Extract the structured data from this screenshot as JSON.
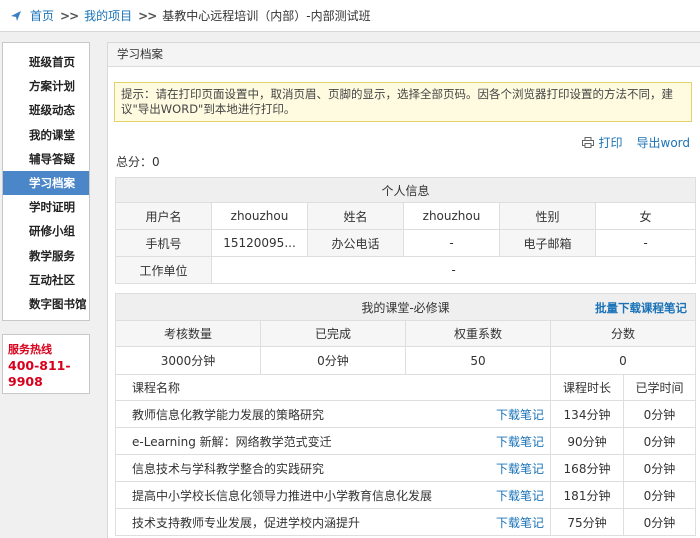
{
  "breadcrumb": {
    "home": "首页",
    "sep": ">>",
    "project": "我的项目",
    "current": "基教中心远程培训（内部）-内部测试班"
  },
  "sidebar": {
    "items": [
      {
        "label": "班级首页",
        "active": false
      },
      {
        "label": "方案计划",
        "active": false
      },
      {
        "label": "班级动态",
        "active": false
      },
      {
        "label": "我的课堂",
        "active": false
      },
      {
        "label": "辅导答疑",
        "active": false
      },
      {
        "label": "学习档案",
        "active": true
      },
      {
        "label": "学时证明",
        "active": false
      },
      {
        "label": "研修小组",
        "active": false
      },
      {
        "label": "教学服务",
        "active": false
      },
      {
        "label": "互动社区",
        "active": false
      },
      {
        "label": "数字图书馆",
        "active": false
      }
    ]
  },
  "hotline": {
    "label": "服务热线",
    "line1": "400-811-",
    "line2": "9908"
  },
  "main": {
    "title": "学习档案",
    "notice": "提示：请在打印页面设置中，取消页眉、页脚的显示，选择全部页码。因各个浏览器打印设置的方法不同，建议\"导出WORD\"到本地进行打印。",
    "print_label": "打印",
    "export_label": "导出word",
    "total": "总分：0"
  },
  "personal": {
    "title": "个人信息",
    "username_label": "用户名",
    "username": "zhouzhou",
    "name_label": "姓名",
    "name": "zhouzhou",
    "gender_label": "性别",
    "gender": "女",
    "phone_label": "手机号",
    "phone": "15120095...",
    "office_label": "办公电话",
    "office": "-",
    "email_label": "电子邮箱",
    "email": "-",
    "work_label": "工作单位",
    "work": "-"
  },
  "courses": {
    "title": "我的课堂-必修课",
    "batch_download": "批量下载课程笔记",
    "summary_headers": [
      "考核数量",
      "已完成",
      "权重系数",
      "分数"
    ],
    "summary_values": [
      "3000分钟",
      "0分钟",
      "50",
      "0"
    ],
    "list_headers": [
      "课程名称",
      "课程时长",
      "已学时间"
    ],
    "download_label": "下载笔记",
    "items": [
      {
        "name": "教师信息化教学能力发展的策略研究",
        "duration": "134分钟",
        "studied": "0分钟"
      },
      {
        "name": "e-Learning 新解：网络教学范式变迁",
        "duration": "90分钟",
        "studied": "0分钟"
      },
      {
        "name": "信息技术与学科教学整合的实践研究",
        "duration": "168分钟",
        "studied": "0分钟"
      },
      {
        "name": "提高中小学校长信息化领导力推进中小学教育信息化发展",
        "duration": "181分钟",
        "studied": "0分钟"
      },
      {
        "name": "技术支持教师专业发展，促进学校内涵提升",
        "duration": "75分钟",
        "studied": "0分钟"
      }
    ]
  },
  "colors": {
    "link": "#1a73b8",
    "sidebar_active": "#4a86c8",
    "hotline": "#d8001c",
    "notice_bg": "#fffbe0"
  }
}
